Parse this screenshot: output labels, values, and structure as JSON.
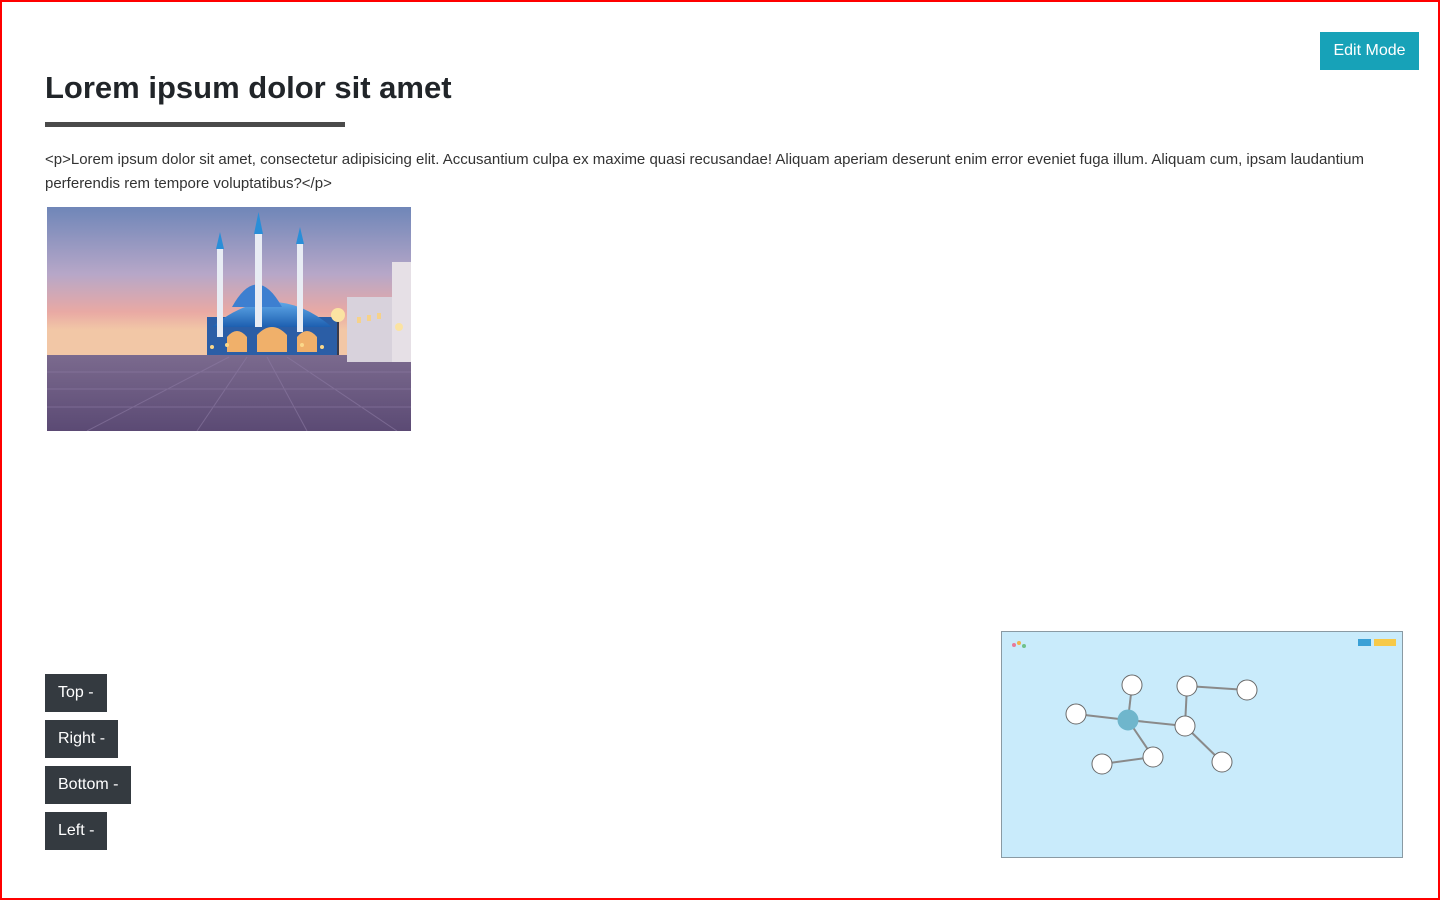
{
  "header": {
    "edit_mode_label": "Edit Mode",
    "title": "Lorem ipsum dolor sit amet"
  },
  "content": {
    "paragraph": "<p>Lorem ipsum dolor sit amet, consectetur adipisicing elit. Accusantium culpa ex maxime quasi recusandae! Aliquam aperiam deserunt enim error eveniet fuga illum. Aliquam cum, ipsam laudantium perferendis rem tempore voluptatibus?</p>",
    "image": {
      "subject": "mosque at dusk",
      "icon": "photo"
    }
  },
  "position_controls": [
    {
      "label": "Top -"
    },
    {
      "label": "Right -"
    },
    {
      "label": "Bottom -"
    },
    {
      "label": "Left -"
    }
  ],
  "minimap": {
    "background": "#c9ebfb",
    "node_color": "#ffffff",
    "active_node_color": "#6fb6cc",
    "edge_color": "#8a8a8a",
    "toolbar_colors": [
      "#3aa0d6",
      "#f7c948"
    ]
  },
  "colors": {
    "accent": "#17a2b8",
    "dark_button": "#343a40",
    "frame_border": "#ff0000"
  }
}
